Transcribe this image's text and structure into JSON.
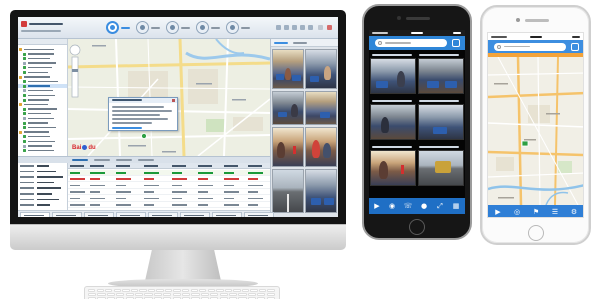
{
  "colors": {
    "monitor_bezel": "#141414",
    "toolbar_active": "#3b8de0",
    "map_background": "#edefe3",
    "river": "#9cc9ec",
    "phone_header_blue": "#2f86d8",
    "phone_toolbar_blue": "#1f6fc5",
    "alert_strip_orange": "#f3a33a",
    "vehicle_marker_green": "#2ea043"
  },
  "monitor": {
    "toolbar_icons": [
      "monitor-icon",
      "video-icon",
      "track-icon",
      "playback-icon",
      "alarm-icon"
    ],
    "map": {
      "logo": {
        "part1": "Bai",
        "part2": "du"
      }
    }
  },
  "phone_left": {
    "toolbar_icons": [
      "play-icon",
      "capture-icon",
      "talk-icon",
      "record-icon",
      "fullscreen-icon",
      "layout-icon"
    ]
  },
  "phone_right": {
    "nav_icons": [
      "video-icon",
      "location-icon",
      "alarm-icon",
      "list-icon",
      "settings-icon"
    ]
  }
}
